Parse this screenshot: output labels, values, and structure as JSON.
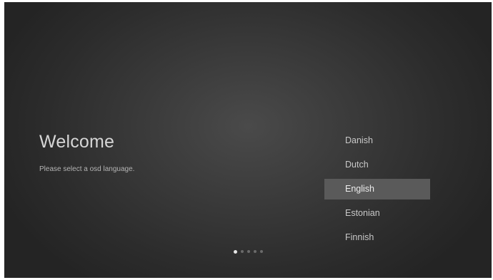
{
  "welcome": {
    "title": "Welcome",
    "subtitle": "Please select a osd language."
  },
  "languages": [
    {
      "label": "Danish",
      "selected": false
    },
    {
      "label": "Dutch",
      "selected": false
    },
    {
      "label": "English",
      "selected": true
    },
    {
      "label": "Estonian",
      "selected": false
    },
    {
      "label": "Finnish",
      "selected": false
    }
  ],
  "pager": {
    "total_steps": 5,
    "current_step": 1
  },
  "colors": {
    "background": "#3a3a3a",
    "selection_highlight": "#5a5a5a",
    "text": "#c8c8c8",
    "active_dot": "#e6e6e6",
    "inactive_dot": "#6a6a6a"
  }
}
